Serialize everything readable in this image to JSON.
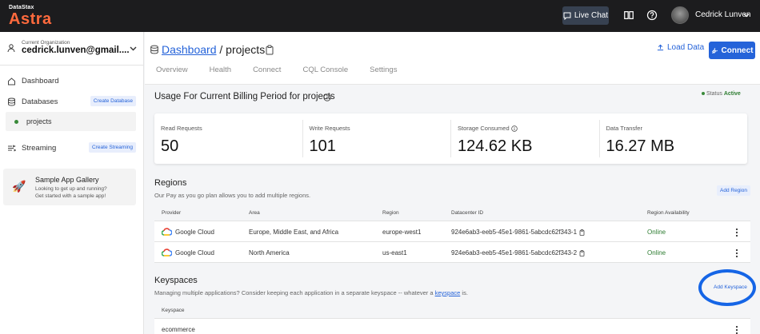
{
  "topbar": {
    "logo_small": "DataStax",
    "logo_big": "Astra",
    "live_chat": "Live Chat",
    "user_name": "Cedrick Lunven",
    "colors": {
      "bar": "#1c1c1e",
      "logo": "#ff6a3d"
    }
  },
  "sidebar": {
    "org_label": "Current Organization",
    "org_name": "cedrick.lunven@gmail....",
    "items": [
      {
        "label": "Dashboard",
        "icon": "home-icon"
      },
      {
        "label": "Databases",
        "icon": "database-icon",
        "action": "Create Database"
      },
      {
        "label": "Streaming",
        "icon": "streaming-icon",
        "action": "Create Streaming"
      }
    ],
    "db_item": "projects",
    "sample": {
      "title": "Sample App Gallery",
      "subtitle_1": "Looking to get up and running?",
      "subtitle_2": "Get started with a sample app!"
    }
  },
  "header": {
    "crumb_link": "Dashboard",
    "crumb_sep": " / ",
    "crumb_current": "projects",
    "load_data": "Load Data",
    "connect": "Connect",
    "tabs": [
      "Overview",
      "Health",
      "Connect",
      "CQL Console",
      "Settings"
    ]
  },
  "usage": {
    "title": "Usage For Current Billing Period for projects",
    "status_label": "Status",
    "status_value": "Active",
    "metrics": [
      {
        "label": "Read Requests",
        "value": "50"
      },
      {
        "label": "Write Requests",
        "value": "101"
      },
      {
        "label": "Storage Consumed",
        "value": "124.62 KB"
      },
      {
        "label": "Data Transfer",
        "value": "16.27 MB"
      }
    ]
  },
  "regions": {
    "title": "Regions",
    "subtitle": "Our Pay as you go plan allows you to add multiple regions.",
    "add_button": "Add Region",
    "columns": [
      "Provider",
      "Area",
      "Region",
      "Datacenter ID",
      "Region Availability"
    ],
    "rows": [
      {
        "provider": "Google Cloud",
        "area": "Europe, Middle East, and Africa",
        "region": "europe-west1",
        "dc": "924e6ab3-eeb5-45e1-9861-5abcdc62f343-1",
        "availability": "Online"
      },
      {
        "provider": "Google Cloud",
        "area": "North America",
        "region": "us-east1",
        "dc": "924e6ab3-eeb5-45e1-9861-5abcdc62f343-2",
        "availability": "Online"
      }
    ]
  },
  "keyspaces": {
    "title": "Keyspaces",
    "subtitle_before": "Managing multiple applications? Consider keeping each application in a separate keyspace -- whatever a ",
    "subtitle_link": "keyspace",
    "subtitle_after": " is.",
    "add_button": "Add Keyspace",
    "column": "Keyspace",
    "rows": [
      "ecommerce"
    ]
  }
}
